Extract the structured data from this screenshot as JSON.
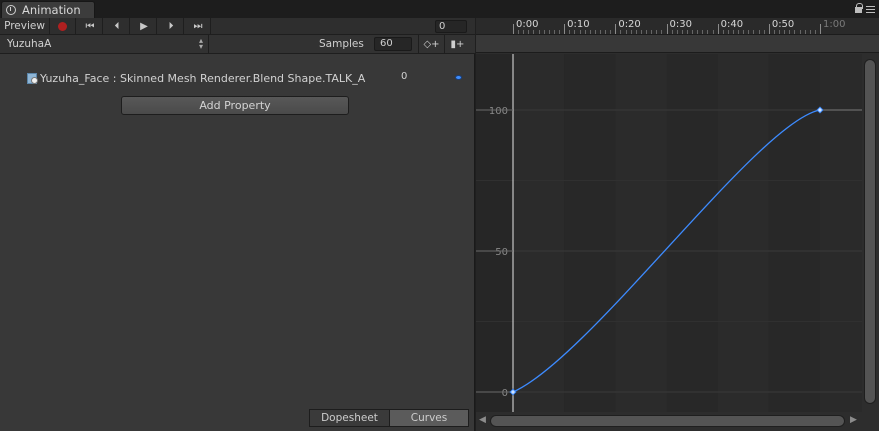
{
  "window": {
    "tab_title": "Animation"
  },
  "toolbar": {
    "preview_label": "Preview",
    "first_key_icon": "⏮",
    "prev_key_icon": "⏴",
    "play_icon": "▶",
    "next_key_icon": "⏵",
    "last_key_icon": "⏭",
    "frame_value": "0"
  },
  "clip": {
    "name": "YuzuhaA",
    "samples_label": "Samples",
    "samples_value": "60"
  },
  "property": {
    "name": "Yuzuha_Face : Skinned Mesh Renderer.Blend Shape.TALK_A",
    "value": "0"
  },
  "add_property_label": "Add Property",
  "modes": {
    "dopesheet": "Dopesheet",
    "curves": "Curves"
  },
  "ruler": {
    "labels": [
      "0:00",
      "0:10",
      "0:20",
      "0:30",
      "0:40",
      "0:50",
      "1:00"
    ]
  },
  "graph": {
    "y_labels": [
      "100",
      "50",
      "0"
    ],
    "curve_color": "#3d8bff"
  },
  "chart_data": {
    "type": "line",
    "x_unit": "seconds:frames",
    "x": [
      0,
      60
    ],
    "y": [
      0,
      100
    ],
    "xlim": [
      0,
      60
    ],
    "ylim": [
      0,
      100
    ],
    "tick_labels_x": [
      "0:00",
      "0:10",
      "0:20",
      "0:30",
      "0:40",
      "0:50",
      "1:00"
    ],
    "tick_labels_y": [
      "0",
      "50",
      "100"
    ]
  }
}
